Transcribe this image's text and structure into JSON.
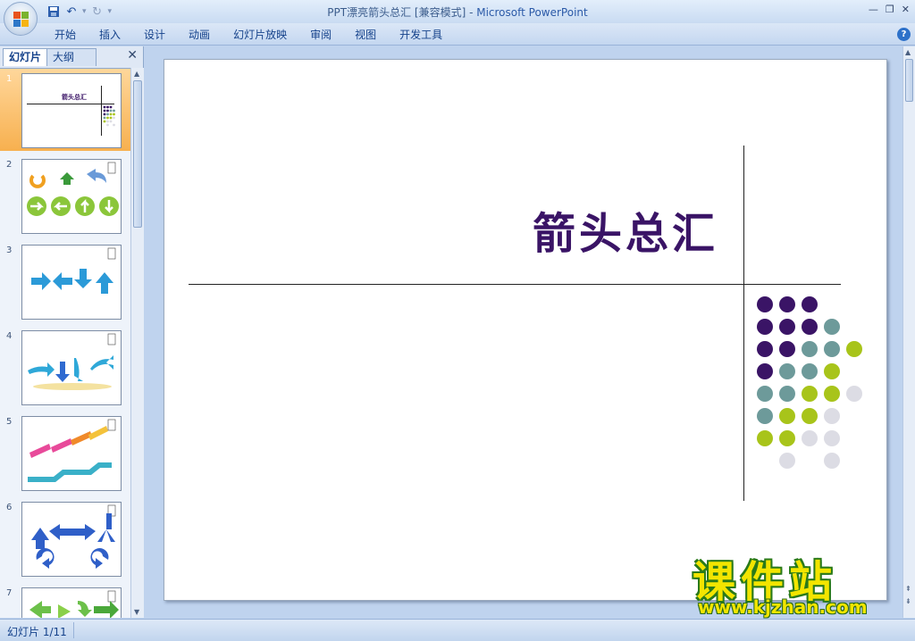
{
  "window": {
    "title_doc": "PPT漂亮箭头总汇 [兼容模式]",
    "title_sep": " - ",
    "title_app": "Microsoft PowerPoint"
  },
  "ribbon": {
    "tabs": [
      "开始",
      "插入",
      "设计",
      "动画",
      "幻灯片放映",
      "审阅",
      "视图",
      "开发工具"
    ],
    "help_label": "?"
  },
  "panel": {
    "tab_slides": "幻灯片",
    "tab_outline": "大纲",
    "close_label": "✕",
    "thumbnails": [
      {
        "num": "1",
        "caption": "箭头总汇"
      },
      {
        "num": "2"
      },
      {
        "num": "3"
      },
      {
        "num": "4"
      },
      {
        "num": "5"
      },
      {
        "num": "6"
      },
      {
        "num": "7"
      }
    ]
  },
  "slide": {
    "title": "箭头总汇"
  },
  "colors": {
    "purple": "#3a1466",
    "teal": "#6d9a9a",
    "lime": "#a8c41a",
    "lightgray": "#dcdce4",
    "selected_thumb": "#f7b04f"
  },
  "watermark": {
    "text": "课件站",
    "url": "www.kjzhan.com"
  },
  "status": {
    "slide_info": "幻灯片 1/11"
  }
}
